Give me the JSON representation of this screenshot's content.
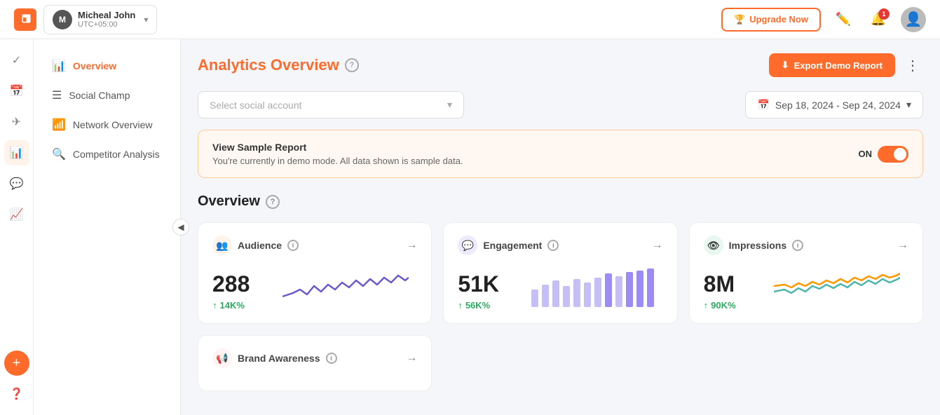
{
  "topbar": {
    "user": {
      "name": "Micheal John",
      "timezone": "UTC+05:00",
      "avatar_initial": "M"
    },
    "upgrade_label": "Upgrade Now",
    "notification_count": "1"
  },
  "sidebar": {
    "items": [
      {
        "id": "overview",
        "label": "Overview",
        "active": true
      },
      {
        "id": "social-champ",
        "label": "Social Champ",
        "active": false
      },
      {
        "id": "network-overview",
        "label": "Network Overview",
        "active": false
      },
      {
        "id": "competitor-analysis",
        "label": "Competitor Analysis",
        "active": false
      }
    ]
  },
  "content": {
    "title": "Analytics Overview",
    "help_icon": "?",
    "export_button": "Export Demo Report",
    "more_button": "⋮",
    "select_account_placeholder": "Select social account",
    "date_range": "Sep 18, 2024 - Sep 24, 2024",
    "demo_banner": {
      "title": "View Sample Report",
      "description": "You're currently in demo mode. All data shown is sample data.",
      "toggle_label": "ON"
    },
    "overview_title": "Overview",
    "cards": [
      {
        "title": "Audience",
        "icon": "👥",
        "value": "288",
        "growth": "14K%",
        "type": "audience"
      },
      {
        "title": "Engagement",
        "icon": "💬",
        "value": "51K",
        "growth": "56K%",
        "type": "engagement"
      },
      {
        "title": "Impressions",
        "icon": "👁",
        "value": "8M",
        "growth": "90K%",
        "type": "impressions"
      }
    ],
    "bottom_cards": [
      {
        "title": "Brand Awareness",
        "icon": "📢"
      }
    ]
  }
}
